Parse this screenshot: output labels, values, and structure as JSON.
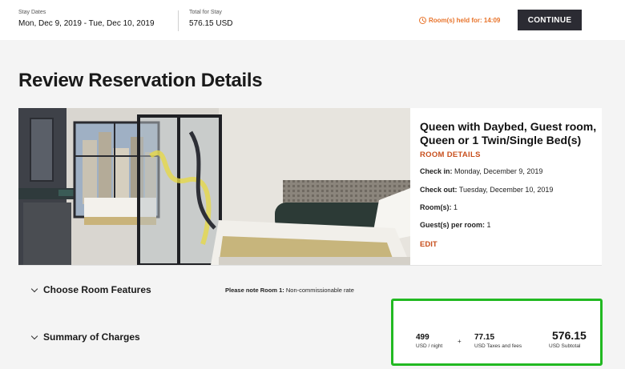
{
  "header": {
    "stay_dates_label": "Stay Dates",
    "stay_dates_value": "Mon, Dec 9, 2019 - Tue, Dec 10, 2019",
    "total_label": "Total for Stay",
    "total_value": "576.15 USD",
    "hold_timer": "Room(s) held for: 14:09",
    "continue_label": "CONTINUE"
  },
  "page": {
    "title": "Review Reservation Details"
  },
  "room": {
    "name": "Queen with Daybed, Guest room, Queen or 1 Twin/Single Bed(s)",
    "details_link": "ROOM DETAILS",
    "check_in_label": "Check in:",
    "check_in_value": "Monday, December 9, 2019",
    "check_out_label": "Check out:",
    "check_out_value": "Tuesday, December 10, 2019",
    "rooms_label": "Room(s):",
    "rooms_value": "1",
    "guests_label": "Guest(s) per room:",
    "guests_value": "1",
    "edit_label": "EDIT"
  },
  "sections": {
    "room_features": "Choose Room Features",
    "summary": "Summary of Charges",
    "note_label": "Please note Room 1:",
    "note_text": "Non-commissionable rate"
  },
  "charges": {
    "rate_value": "499",
    "rate_label": "USD / night",
    "plus": "+",
    "taxes_value": "77.15",
    "taxes_label": "USD Taxes and fees",
    "subtotal_value": "576.15",
    "subtotal_label": "USD Subtotal"
  },
  "colors": {
    "accent": "#c8501e",
    "timer": "#e8732a",
    "button": "#2b2b33",
    "highlight_border": "#22b922"
  }
}
